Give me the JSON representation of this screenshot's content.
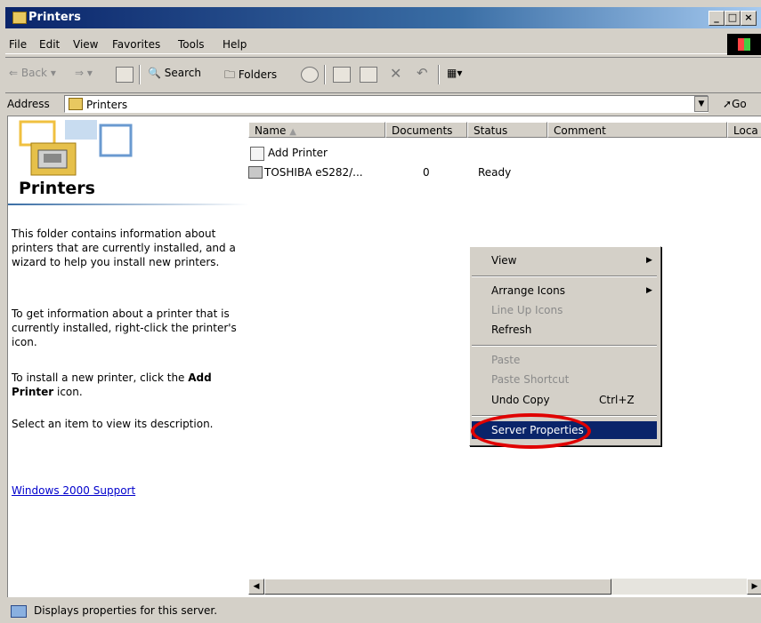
{
  "window": {
    "title": "Printers"
  },
  "menubar": {
    "items": [
      "File",
      "Edit",
      "View",
      "Favorites",
      "Tools",
      "Help"
    ]
  },
  "toolbar": {
    "back": "Back",
    "search": "Search",
    "folders": "Folders"
  },
  "address": {
    "label": "Address",
    "value": "Printers",
    "go": "Go"
  },
  "left": {
    "title": "Printers",
    "p1": "This folder contains information about printers that are currently installed, and a wizard to help you install new printers.",
    "p2": "To get information about a printer that is currently installed, right-click the printer's icon.",
    "p3_pre": "To install a new printer, click the ",
    "p3_bold1": "Add",
    "p3_bold2": "Printer",
    "p3_post": " icon.",
    "p4": "Select an item to view its description.",
    "support_link": "Windows 2000 Support"
  },
  "list": {
    "columns": [
      "Name",
      "Documents",
      "Status",
      "Comment",
      "Loca"
    ],
    "rows": [
      {
        "name": "Add Printer",
        "documents": "",
        "status": ""
      },
      {
        "name": "TOSHIBA eS282/...",
        "documents": "0",
        "status": "Ready"
      }
    ]
  },
  "context_menu": {
    "view": "View",
    "arrange": "Arrange Icons",
    "lineup": "Line Up Icons",
    "refresh": "Refresh",
    "paste": "Paste",
    "paste_shortcut": "Paste Shortcut",
    "undo": "Undo Copy",
    "undo_shortcut": "Ctrl+Z",
    "server": "Server Properties"
  },
  "status": {
    "text": "Displays properties for this server."
  },
  "colors": {
    "titlebar": "#0a246a",
    "highlight": "#0a246a",
    "annotation": "#e00000"
  }
}
